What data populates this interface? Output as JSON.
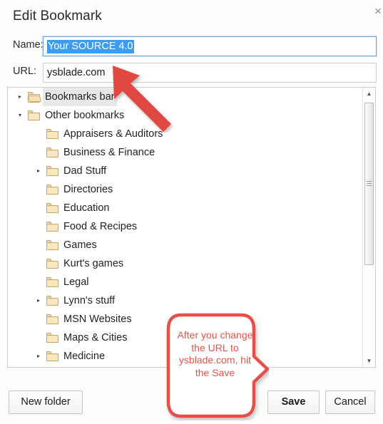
{
  "dialog": {
    "title": "Edit Bookmark",
    "close_label": "×"
  },
  "form": {
    "name": {
      "label": "Name:",
      "value": "Your SOURCE 4.0",
      "selected": true
    },
    "url": {
      "label": "URL:",
      "value": "ysblade.com",
      "selected": false
    }
  },
  "tree": {
    "rows": [
      {
        "label": "Bookmarks bar",
        "depth": 0,
        "twisty": "▸",
        "folder": "open",
        "selected": true
      },
      {
        "label": "Other bookmarks",
        "depth": 0,
        "twisty": "▾",
        "folder": "closed",
        "selected": false
      },
      {
        "label": "Appraisers & Auditors",
        "depth": 1,
        "twisty": "",
        "folder": "closed",
        "selected": false
      },
      {
        "label": "Business & Finance",
        "depth": 1,
        "twisty": "",
        "folder": "closed",
        "selected": false
      },
      {
        "label": "Dad Stuff",
        "depth": 1,
        "twisty": "▸",
        "folder": "closed",
        "selected": false
      },
      {
        "label": "Directories",
        "depth": 1,
        "twisty": "",
        "folder": "closed",
        "selected": false
      },
      {
        "label": "Education",
        "depth": 1,
        "twisty": "",
        "folder": "closed",
        "selected": false
      },
      {
        "label": "Food & Recipes",
        "depth": 1,
        "twisty": "",
        "folder": "closed",
        "selected": false
      },
      {
        "label": "Games",
        "depth": 1,
        "twisty": "",
        "folder": "closed",
        "selected": false
      },
      {
        "label": "Kurt's games",
        "depth": 1,
        "twisty": "",
        "folder": "closed",
        "selected": false
      },
      {
        "label": "Legal",
        "depth": 1,
        "twisty": "",
        "folder": "closed",
        "selected": false
      },
      {
        "label": "Lynn's stuff",
        "depth": 1,
        "twisty": "▸",
        "folder": "closed",
        "selected": false
      },
      {
        "label": "MSN Websites",
        "depth": 1,
        "twisty": "",
        "folder": "closed",
        "selected": false
      },
      {
        "label": "Maps & Cities",
        "depth": 1,
        "twisty": "",
        "folder": "closed",
        "selected": false
      },
      {
        "label": "Medicine",
        "depth": 1,
        "twisty": "▸",
        "folder": "closed",
        "selected": false
      }
    ]
  },
  "scrollbar": {
    "up_arrow": "▲",
    "down_arrow": "▼"
  },
  "buttons": {
    "new_folder": "New folder",
    "save": "Save",
    "cancel": "Cancel"
  },
  "annotations": {
    "callout_text": "After you change the URL to ysblade.com, hit the Save",
    "accent_color": "#e8504a",
    "arrow_color": "#e04a42"
  },
  "colors": {
    "selection_blue": "#3e9bf0",
    "focus_border": "#6aa3dd",
    "folder_fill": "#fae7c0",
    "folder_stroke": "#c9a464"
  }
}
